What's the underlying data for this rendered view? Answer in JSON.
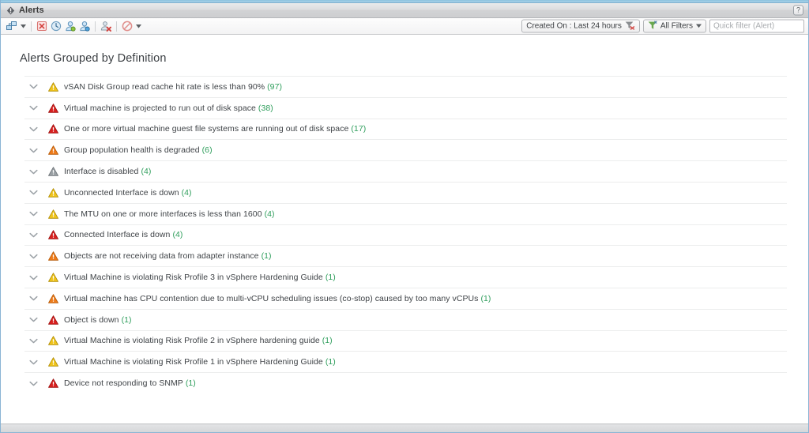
{
  "window": {
    "title": "Alerts",
    "app_icon": "alert-diamond-icon",
    "help_label": "?"
  },
  "toolbar": {
    "buttons": [
      {
        "name": "open-relationship-icon",
        "label": "Open Relationship"
      },
      {
        "name": "cancel-alert-icon",
        "label": "Cancel Alert"
      },
      {
        "name": "suspend-alert-icon",
        "label": "Suspend Alert"
      },
      {
        "name": "take-ownership-icon",
        "label": "Take Ownership"
      },
      {
        "name": "assign-owner-icon",
        "label": "Assign Owner"
      },
      {
        "name": "release-ownership-icon",
        "label": "Release Ownership"
      },
      {
        "name": "suppress-icon",
        "label": "Suppress"
      }
    ],
    "created_on_filter": "Created On : Last 24 hours",
    "all_filters_label": "All Filters",
    "quick_filter_placeholder": "Quick filter (Alert)",
    "quick_filter_value": ""
  },
  "main": {
    "page_title": "Alerts Grouped by Definition",
    "severity_colors": {
      "critical": "#d9201f",
      "immediate": "#ef7c1b",
      "warning": "#f0c41b",
      "info": "#9aa0a4"
    },
    "count_color": "#2f9e5c",
    "alerts": [
      {
        "severity": "warning",
        "text": "vSAN Disk Group read cache hit rate is less than 90%",
        "count": "(97)"
      },
      {
        "severity": "critical",
        "text": "Virtual machine is projected to run out of disk space",
        "count": "(38)"
      },
      {
        "severity": "critical",
        "text": "One or more virtual machine guest file systems are running out of disk space",
        "count": "(17)"
      },
      {
        "severity": "immediate",
        "text": "Group population health is degraded",
        "count": "(6)"
      },
      {
        "severity": "info",
        "text": "Interface is disabled",
        "count": "(4)"
      },
      {
        "severity": "warning",
        "text": "Unconnected Interface is down",
        "count": "(4)"
      },
      {
        "severity": "warning",
        "text": "The MTU on one or more interfaces is less than 1600",
        "count": "(4)"
      },
      {
        "severity": "critical",
        "text": "Connected Interface is down",
        "count": "(4)"
      },
      {
        "severity": "immediate",
        "text": "Objects are not receiving data from adapter instance",
        "count": "(1)"
      },
      {
        "severity": "warning",
        "text": "Virtual Machine is violating Risk Profile 3 in vSphere Hardening Guide",
        "count": "(1)"
      },
      {
        "severity": "immediate",
        "text": "Virtual machine has CPU contention due to multi-vCPU scheduling issues (co-stop) caused by too many vCPUs",
        "count": "(1)"
      },
      {
        "severity": "critical",
        "text": "Object is down",
        "count": "(1)"
      },
      {
        "severity": "warning",
        "text": "Virtual Machine is violating Risk Profile 2 in vSphere hardening guide",
        "count": "(1)"
      },
      {
        "severity": "warning",
        "text": "Virtual Machine is violating Risk Profile 1 in vSphere Hardening Guide",
        "count": "(1)"
      },
      {
        "severity": "critical",
        "text": "Device not responding to SNMP",
        "count": "(1)"
      }
    ]
  }
}
